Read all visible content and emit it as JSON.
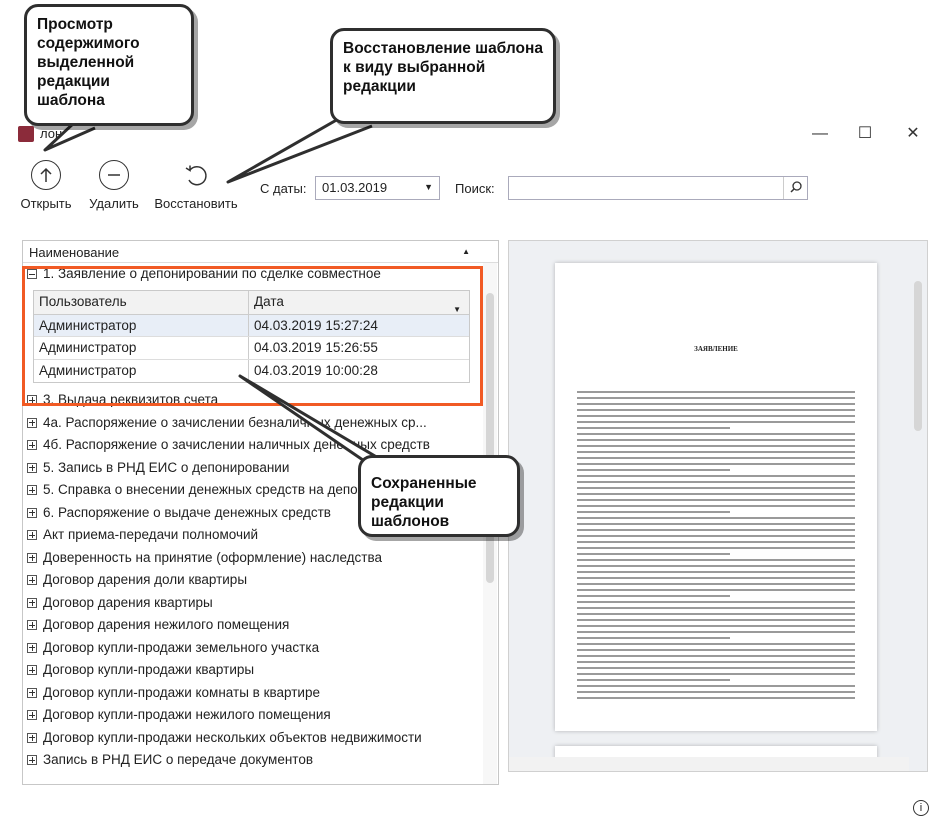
{
  "window": {
    "title_visible": "лонов",
    "min": "—",
    "max": "☐",
    "close": "✕"
  },
  "toolbar": {
    "open_label": "Открыть",
    "delete_label": "Удалить",
    "restore_label": "Восстановить",
    "date_label": "С даты:",
    "date_value": "01.03.2019",
    "search_label": "Поиск:",
    "search_value": ""
  },
  "tree": {
    "header": "Наименование",
    "expanded_item": "1. Заявление о депонировании по сделке совместное",
    "sub_grid": {
      "columns": [
        "Пользователь",
        "Дата"
      ],
      "rows": [
        {
          "user": "Администратор",
          "date": "04.03.2019 15:27:24"
        },
        {
          "user": "Администратор",
          "date": "04.03.2019 15:26:55"
        },
        {
          "user": "Администратор",
          "date": "04.03.2019 10:00:28"
        }
      ]
    },
    "items": [
      "3. Выдача реквизитов счета",
      "4а. Распоряжение о зачислении безналичных денежных ср...",
      "4б. Распоряжение о зачислении наличных денежных средств",
      "5. Запись в РНД ЕИС о депонировании",
      "5. Справка о внесении денежных средств на депозит",
      "6. Распоряжение о выдаче денежных средств",
      "Акт приема-передачи полномочий",
      "Доверенность на принятие (оформление) наследства",
      "Договор дарения доли квартиры",
      "Договор дарения квартиры",
      "Договор дарения нежилого помещения",
      "Договор купли-продажи земельного участка",
      "Договор купли-продажи квартиры",
      "Договор купли-продажи комнаты в квартире",
      "Договор купли-продажи нежилого помещения",
      "Договор купли-продажи нескольких объектов недвижимости",
      "Запись в РНД ЕИС о передаче документов"
    ]
  },
  "preview": {
    "doc_title": "ЗАЯВЛЕНИЕ"
  },
  "callouts": {
    "view": "Просмотр содержимого выделенной редакции шаблона",
    "restore": "Восстановление шаблона к виду выбранной редакции",
    "saved": "Сохраненные редакции шаблонов"
  },
  "colors": {
    "highlight_frame": "#f15a24",
    "selected_row": "#e8eef7"
  }
}
